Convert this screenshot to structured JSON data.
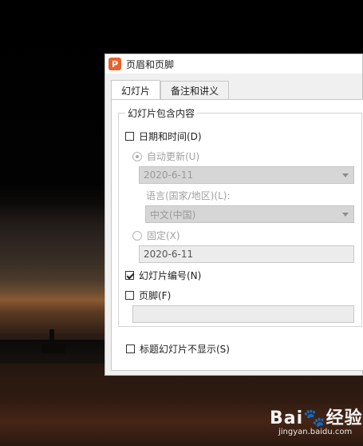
{
  "dialog": {
    "title": "页眉和页脚",
    "app_icon_glyph": "P"
  },
  "tabs": [
    {
      "label": "幻灯片",
      "active": true
    },
    {
      "label": "备注和讲义",
      "active": false
    }
  ],
  "group": {
    "title": "幻灯片包含内容",
    "date_time": {
      "label": "日期和时间(D)",
      "checked": false
    },
    "auto_update": {
      "label": "自动更新(U)",
      "selected": true,
      "disabled": true
    },
    "auto_date": {
      "value": "2020-6-11"
    },
    "language_label": "语言(国家/地区)(L):",
    "language": {
      "value": "中文(中国)"
    },
    "fixed": {
      "label": "固定(X)",
      "selected": false,
      "disabled": true
    },
    "fixed_date": {
      "value": "2020-6-11"
    },
    "slide_number": {
      "label": "幻灯片编号(N)",
      "checked": true
    },
    "footer": {
      "label": "页脚(F)",
      "checked": false,
      "value": ""
    }
  },
  "title_slide": {
    "label": "标题幻灯片不显示(S)",
    "checked": false
  },
  "watermark": {
    "brand": "Bai",
    "brand2": "经验",
    "url": "jingyan.baidu.com"
  }
}
